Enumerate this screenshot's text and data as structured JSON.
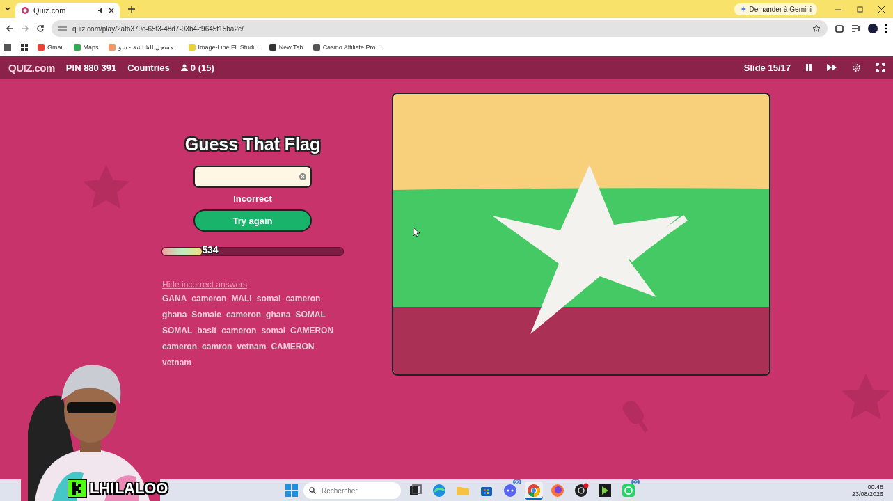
{
  "browser": {
    "tabs": [
      {
        "title": "Quiz.com",
        "selected": true
      }
    ],
    "address": "quiz.com/play/2afb379c-65f3-48d7-93b4-f9645f15ba2c/",
    "gemini": "Demander à Gemini",
    "bookmarks": [
      "Gmail",
      "Maps",
      "مسجل الشاشة - سو...",
      "Image-Line FL Studi...",
      "New Tab",
      "Casino Affiliate Pro..."
    ]
  },
  "quiz_bar": {
    "logo": "QUIZ.com",
    "pin": "PIN 880 391",
    "category": "Countries",
    "players": "0 (15)",
    "slide": "Slide 15/17"
  },
  "game": {
    "title": "Guess That Flag",
    "feedback": "Incorrect",
    "button": "Try again",
    "score": {
      "level": 0.22,
      "value": "534"
    },
    "hide_link": "Hide incorrect answers",
    "wrong_answers": [
      "GANA",
      "cameron",
      "MALI",
      "somal",
      "cameron",
      "ghana",
      "Somale",
      "cameron",
      "ghana",
      "SOMAL",
      "SOMAL",
      "basit",
      "cameron",
      "somal",
      "CAMERON",
      "cameron",
      "camron",
      "vetnam",
      "CAMERON",
      "vetnam"
    ]
  },
  "overlay": {
    "name": "LHILALOO"
  },
  "taskbar": {
    "search_placeholder": "Rechercher",
    "apps": [
      {
        "kind": "taskview",
        "selected": false
      },
      {
        "kind": "edge",
        "selected": false
      },
      {
        "kind": "folder",
        "selected": false
      },
      {
        "kind": "store",
        "selected": false
      },
      {
        "kind": "discord",
        "selected": false,
        "badge": "99"
      },
      {
        "kind": "chrome",
        "selected": true
      },
      {
        "kind": "firefox",
        "selected": false
      },
      {
        "kind": "obs",
        "selected": false
      },
      {
        "kind": "player",
        "selected": false
      },
      {
        "kind": "whatsapp",
        "selected": false,
        "badge": "39"
      }
    ],
    "time": "00:48",
    "date": "23/08/2026"
  }
}
